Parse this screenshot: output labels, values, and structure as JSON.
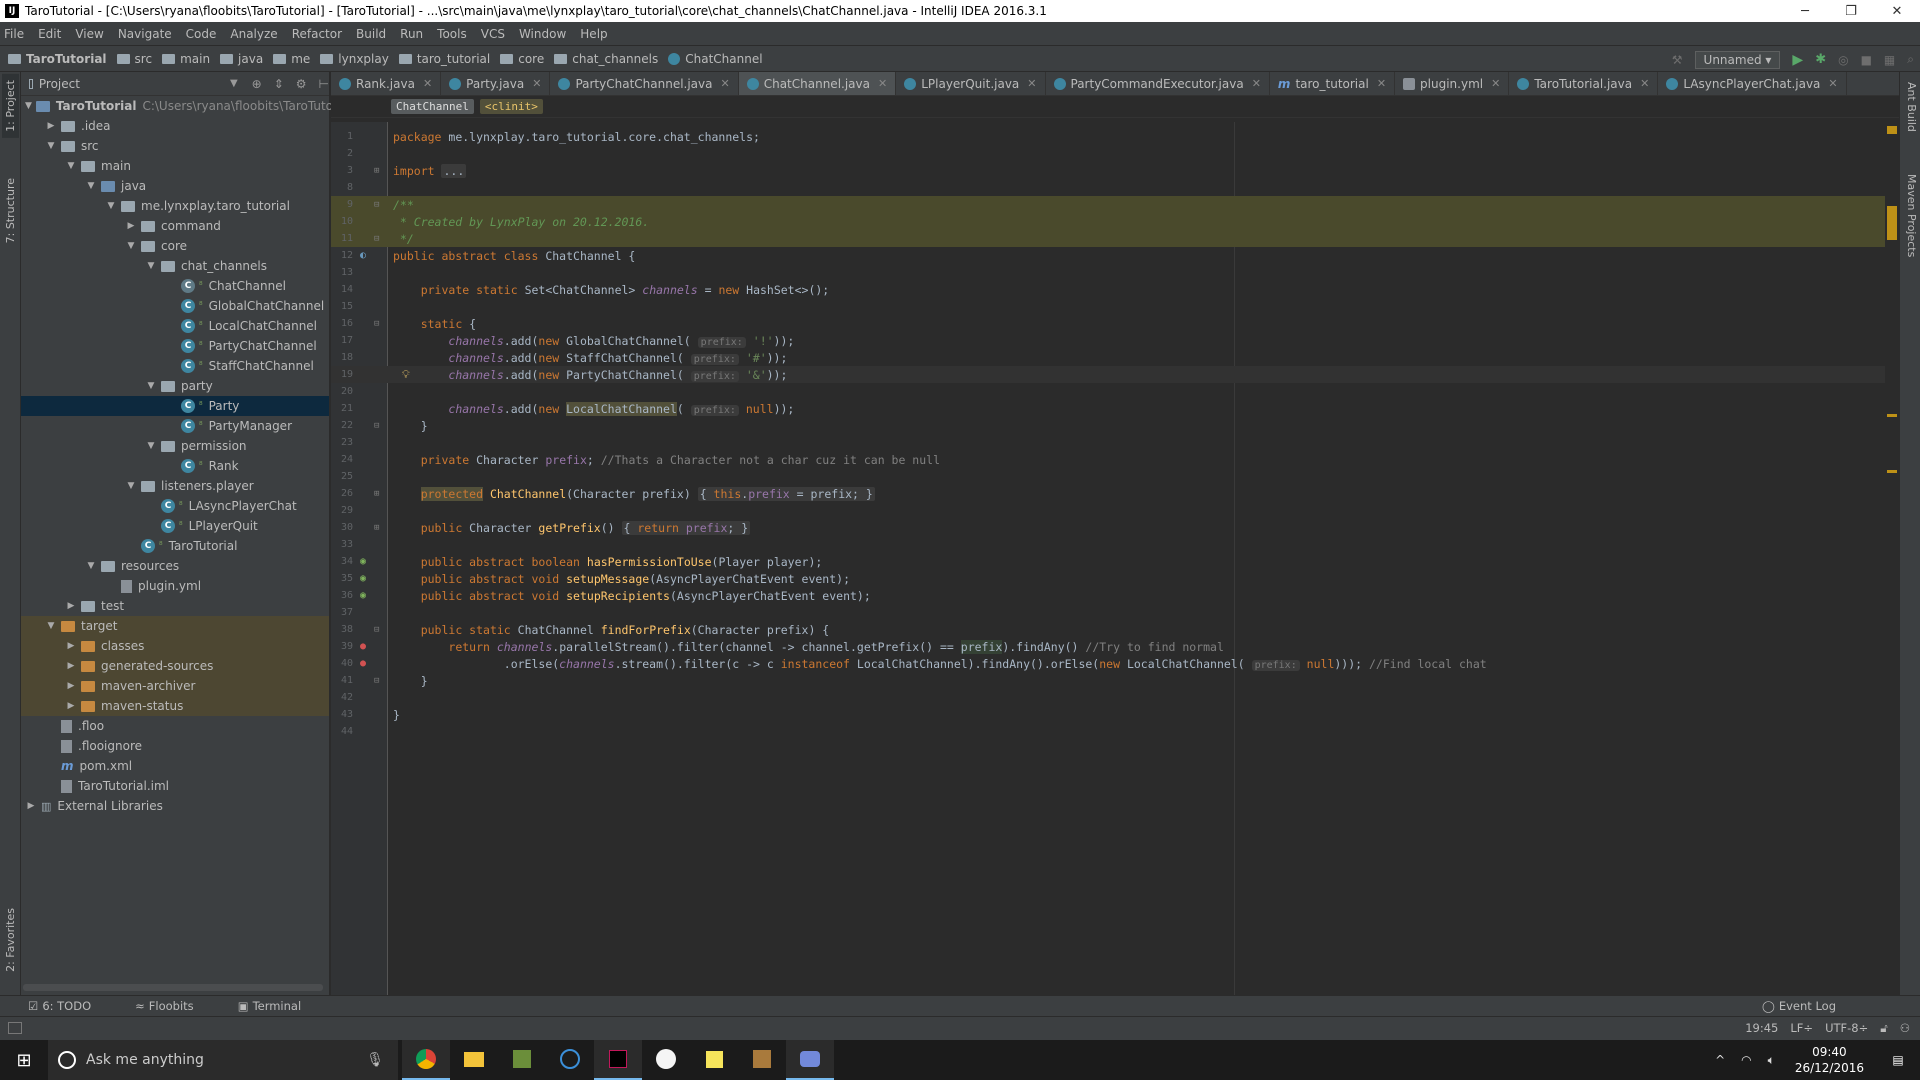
{
  "window": {
    "title": "TaroTutorial - [C:\\Users\\ryana\\floobits\\TaroTutorial] - [TaroTutorial] - ...\\src\\main\\java\\me\\lynxplay\\taro_tutorial\\core\\chat_channels\\ChatChannel.java - IntelliJ IDEA 2016.3.1",
    "logo": "IJ",
    "minimize": "─",
    "maximize": "❐",
    "close": "✕"
  },
  "menu": [
    "File",
    "Edit",
    "View",
    "Navigate",
    "Code",
    "Analyze",
    "Refactor",
    "Build",
    "Run",
    "Tools",
    "VCS",
    "Window",
    "Help"
  ],
  "navbar": {
    "crumbs": [
      "TaroTutorial",
      "src",
      "main",
      "java",
      "me",
      "lynxplay",
      "taro_tutorial",
      "core",
      "chat_channels",
      "ChatChannel"
    ],
    "run_config": "Unnamed ▾"
  },
  "left_strip": {
    "project": "1: Project",
    "structure": "7: Structure",
    "favorites": "2: Favorites"
  },
  "right_strip": {
    "ant": "Ant Build",
    "maven": "Maven Projects"
  },
  "project_panel": {
    "title": "Project",
    "tree": [
      {
        "label": "TaroTutorial",
        "path": "C:\\Users\\ryana\\floobits\\TaroTutorial",
        "indent": 0,
        "arrow": "▼",
        "icon": "folder-blue",
        "bold": true
      },
      {
        "label": ".idea",
        "indent": 1,
        "arrow": "▶",
        "icon": "folder"
      },
      {
        "label": "src",
        "indent": 1,
        "arrow": "▼",
        "icon": "folder"
      },
      {
        "label": "main",
        "indent": 2,
        "arrow": "▼",
        "icon": "folder"
      },
      {
        "label": "java",
        "indent": 3,
        "arrow": "▼",
        "icon": "folder-blue"
      },
      {
        "label": "me.lynxplay.taro_tutorial",
        "indent": 4,
        "arrow": "▼",
        "icon": "folder"
      },
      {
        "label": "command",
        "indent": 5,
        "arrow": "▶",
        "icon": "folder"
      },
      {
        "label": "core",
        "indent": 5,
        "arrow": "▼",
        "icon": "folder"
      },
      {
        "label": "chat_channels",
        "indent": 6,
        "arrow": "▼",
        "icon": "folder"
      },
      {
        "label": "ChatChannel",
        "indent": 7,
        "arrow": "",
        "icon": "class-abstract"
      },
      {
        "label": "GlobalChatChannel",
        "indent": 7,
        "arrow": "",
        "icon": "class"
      },
      {
        "label": "LocalChatChannel",
        "indent": 7,
        "arrow": "",
        "icon": "class"
      },
      {
        "label": "PartyChatChannel",
        "indent": 7,
        "arrow": "",
        "icon": "class"
      },
      {
        "label": "StaffChatChannel",
        "indent": 7,
        "arrow": "",
        "icon": "class"
      },
      {
        "label": "party",
        "indent": 6,
        "arrow": "▼",
        "icon": "folder"
      },
      {
        "label": "Party",
        "indent": 7,
        "arrow": "",
        "icon": "class",
        "selected": true
      },
      {
        "label": "PartyManager",
        "indent": 7,
        "arrow": "",
        "icon": "class"
      },
      {
        "label": "permission",
        "indent": 6,
        "arrow": "▼",
        "icon": "folder"
      },
      {
        "label": "Rank",
        "indent": 7,
        "arrow": "",
        "icon": "class"
      },
      {
        "label": "listeners.player",
        "indent": 5,
        "arrow": "▼",
        "icon": "folder"
      },
      {
        "label": "LAsyncPlayerChat",
        "indent": 6,
        "arrow": "",
        "icon": "class"
      },
      {
        "label": "LPlayerQuit",
        "indent": 6,
        "arrow": "",
        "icon": "class"
      },
      {
        "label": "TaroTutorial",
        "indent": 5,
        "arrow": "",
        "icon": "class"
      },
      {
        "label": "resources",
        "indent": 3,
        "arrow": "▼",
        "icon": "folder"
      },
      {
        "label": "plugin.yml",
        "indent": 4,
        "arrow": "",
        "icon": "file"
      },
      {
        "label": "test",
        "indent": 2,
        "arrow": "▶",
        "icon": "folder"
      },
      {
        "label": "target",
        "indent": 1,
        "arrow": "▼",
        "icon": "folder-orange",
        "target": true
      },
      {
        "label": "classes",
        "indent": 2,
        "arrow": "▶",
        "icon": "folder-orange",
        "target": true
      },
      {
        "label": "generated-sources",
        "indent": 2,
        "arrow": "▶",
        "icon": "folder-orange",
        "target": true
      },
      {
        "label": "maven-archiver",
        "indent": 2,
        "arrow": "▶",
        "icon": "folder-orange",
        "target": true
      },
      {
        "label": "maven-status",
        "indent": 2,
        "arrow": "▶",
        "icon": "folder-orange",
        "target": true
      },
      {
        "label": ".floo",
        "indent": 1,
        "arrow": "",
        "icon": "file"
      },
      {
        "label": ".flooignore",
        "indent": 1,
        "arrow": "",
        "icon": "file"
      },
      {
        "label": "pom.xml",
        "indent": 1,
        "arrow": "",
        "icon": "maven"
      },
      {
        "label": "TaroTutorial.iml",
        "indent": 1,
        "arrow": "",
        "icon": "file"
      },
      {
        "label": "External Libraries",
        "indent": 0,
        "arrow": "▶",
        "icon": "library"
      }
    ]
  },
  "tabs": [
    {
      "label": "Rank.java",
      "icon": "class"
    },
    {
      "label": "Party.java",
      "icon": "class"
    },
    {
      "label": "PartyChatChannel.java",
      "icon": "class"
    },
    {
      "label": "ChatChannel.java",
      "icon": "class",
      "active": true
    },
    {
      "label": "LPlayerQuit.java",
      "icon": "class"
    },
    {
      "label": "PartyCommandExecutor.java",
      "icon": "class"
    },
    {
      "label": "taro_tutorial",
      "icon": "maven"
    },
    {
      "label": "plugin.yml",
      "icon": "file"
    },
    {
      "label": "TaroTutorial.java",
      "icon": "class"
    },
    {
      "label": "LAsyncPlayerChat.java",
      "icon": "class"
    }
  ],
  "editor_breadcrumb": [
    "ChatChannel",
    "<clinit>"
  ],
  "code": [
    {
      "n": "1",
      "html": "<span class='kw'>package</span> me.lynxplay.taro_tutorial.core.chat_channels;"
    },
    {
      "n": "2",
      "html": ""
    },
    {
      "n": "3",
      "html": "<span class='kw'>import</span> <span class='fold-pill'>...</span>",
      "fold": "+"
    },
    {
      "n": "8",
      "html": ""
    },
    {
      "n": "9",
      "html": "<span class='dc'>/**</span>",
      "bg": "comment",
      "fold": "−"
    },
    {
      "n": "10",
      "html": "<span class='dc'> * Created by LynxPlay on 20.12.2016.</span>",
      "bg": "comment"
    },
    {
      "n": "11",
      "html": "<span class='dc'> */</span>",
      "bg": "comment",
      "fold": "−"
    },
    {
      "n": "12",
      "html": "<span class='kw'>public abstract class</span> ChatChannel {",
      "mark": "over"
    },
    {
      "n": "13",
      "html": ""
    },
    {
      "n": "14",
      "html": "    <span class='kw'>private static</span> Set&lt;ChatChannel&gt; <span class='fld'>channels</span> = <span class='kw'>new</span> HashSet&lt;&gt;();"
    },
    {
      "n": "15",
      "html": ""
    },
    {
      "n": "16",
      "html": "    <span class='kw'>static</span> {",
      "fold": "−"
    },
    {
      "n": "17",
      "html": "        <span class='fld'>channels</span>.add(<span class='kw'>new</span> GlobalChatChannel( <span class='hint'>prefix:</span> <span class='str'>'!'</span>));"
    },
    {
      "n": "18",
      "html": "        <span class='fld'>channels</span>.add(<span class='kw'>new</span> StaffChatChannel( <span class='hint'>prefix:</span> <span class='str'>'#'</span>));"
    },
    {
      "n": "19",
      "html": "        <span class='fld'>channels</span>.add(<span class='kw'>new</span> PartyChatChannel( <span class='hint'>prefix:</span> <span class='str'>'&amp;'</span>));",
      "bulb": true,
      "bg": "caret"
    },
    {
      "n": "20",
      "html": ""
    },
    {
      "n": "21",
      "html": "        <span class='fld'>channels</span>.add(<span class='kw'>new</span> <span class='hl'>LocalChatChannel</span>( <span class='hint'>prefix:</span> <span class='kw'>null</span>));"
    },
    {
      "n": "22",
      "html": "    }",
      "fold": "−"
    },
    {
      "n": "23",
      "html": ""
    },
    {
      "n": "24",
      "html": "    <span class='kw'>private</span> Character <span class='fld' style='font-style:normal'>prefix</span>; <span class='cm'>//Thats a Character not a char cuz it can be null</span>"
    },
    {
      "n": "25",
      "html": ""
    },
    {
      "n": "26",
      "html": "    <span class='kw warn-hl'>protected</span> <span class='fn'>ChatChannel</span>(Character prefix) <span class='fold-pill'>{ <span class='kw'>this</span>.<span class='fld' style='font-style:normal'>prefix</span> = prefix; }</span>",
      "fold": "+"
    },
    {
      "n": "29",
      "html": ""
    },
    {
      "n": "30",
      "html": "    <span class='kw'>public</span> Character <span class='fn'>getPrefix</span>() <span class='fold-pill'>{ <span class='kw'>return</span> <span class='fld' style='font-style:normal'>prefix</span>; }</span>",
      "fold": "+"
    },
    {
      "n": "33",
      "html": ""
    },
    {
      "n": "34",
      "html": "    <span class='kw'>public abstract boolean</span> <span class='fn'>hasPermissionToUse</span>(Player player);",
      "mark": "impl"
    },
    {
      "n": "35",
      "html": "    <span class='kw'>public abstract void</span> <span class='fn'>setupMessage</span>(AsyncPlayerChatEvent event);",
      "mark": "impl"
    },
    {
      "n": "36",
      "html": "    <span class='kw'>public abstract void</span> <span class='fn'>setupRecipients</span>(AsyncPlayerChatEvent event);",
      "mark": "impl"
    },
    {
      "n": "37",
      "html": ""
    },
    {
      "n": "38",
      "html": "    <span class='kw'>public static</span> ChatChannel <span class='fn'>findForPrefix</span>(Character prefix) {",
      "fold": "−"
    },
    {
      "n": "39",
      "html": "        <span class='kw'>return</span> <span class='fld'>channels</span>.parallelStream().filter(channel -&gt; channel.getPrefix() == <span class='usage'>prefix</span>).findAny() <span class='cm'>//Try to find normal</span>",
      "mark": "err"
    },
    {
      "n": "40",
      "html": "                .orElse(<span class='fld'>channels</span>.stream().filter(c -&gt; c <span class='kw'>instanceof</span> LocalChatChannel).findAny().orElse(<span class='kw'>new</span> LocalChatChannel( <span class='hint'>prefix:</span> <span class='kw'>null</span>))); <span class='cm'>//Find local chat</span>",
      "mark": "err"
    },
    {
      "n": "41",
      "html": "    }",
      "fold": "−"
    },
    {
      "n": "42",
      "html": ""
    },
    {
      "n": "43",
      "html": "}"
    },
    {
      "n": "44",
      "html": ""
    }
  ],
  "bottom_tabs": [
    "6: TODO",
    "Floobits",
    "Terminal"
  ],
  "event_log": "Event Log",
  "status": {
    "position": "19:45",
    "line_sep": "LF÷",
    "encoding": "UTF-8÷"
  },
  "taskbar": {
    "search_placeholder": "Ask me anything",
    "time": "09:40",
    "date": "26/12/2016"
  }
}
